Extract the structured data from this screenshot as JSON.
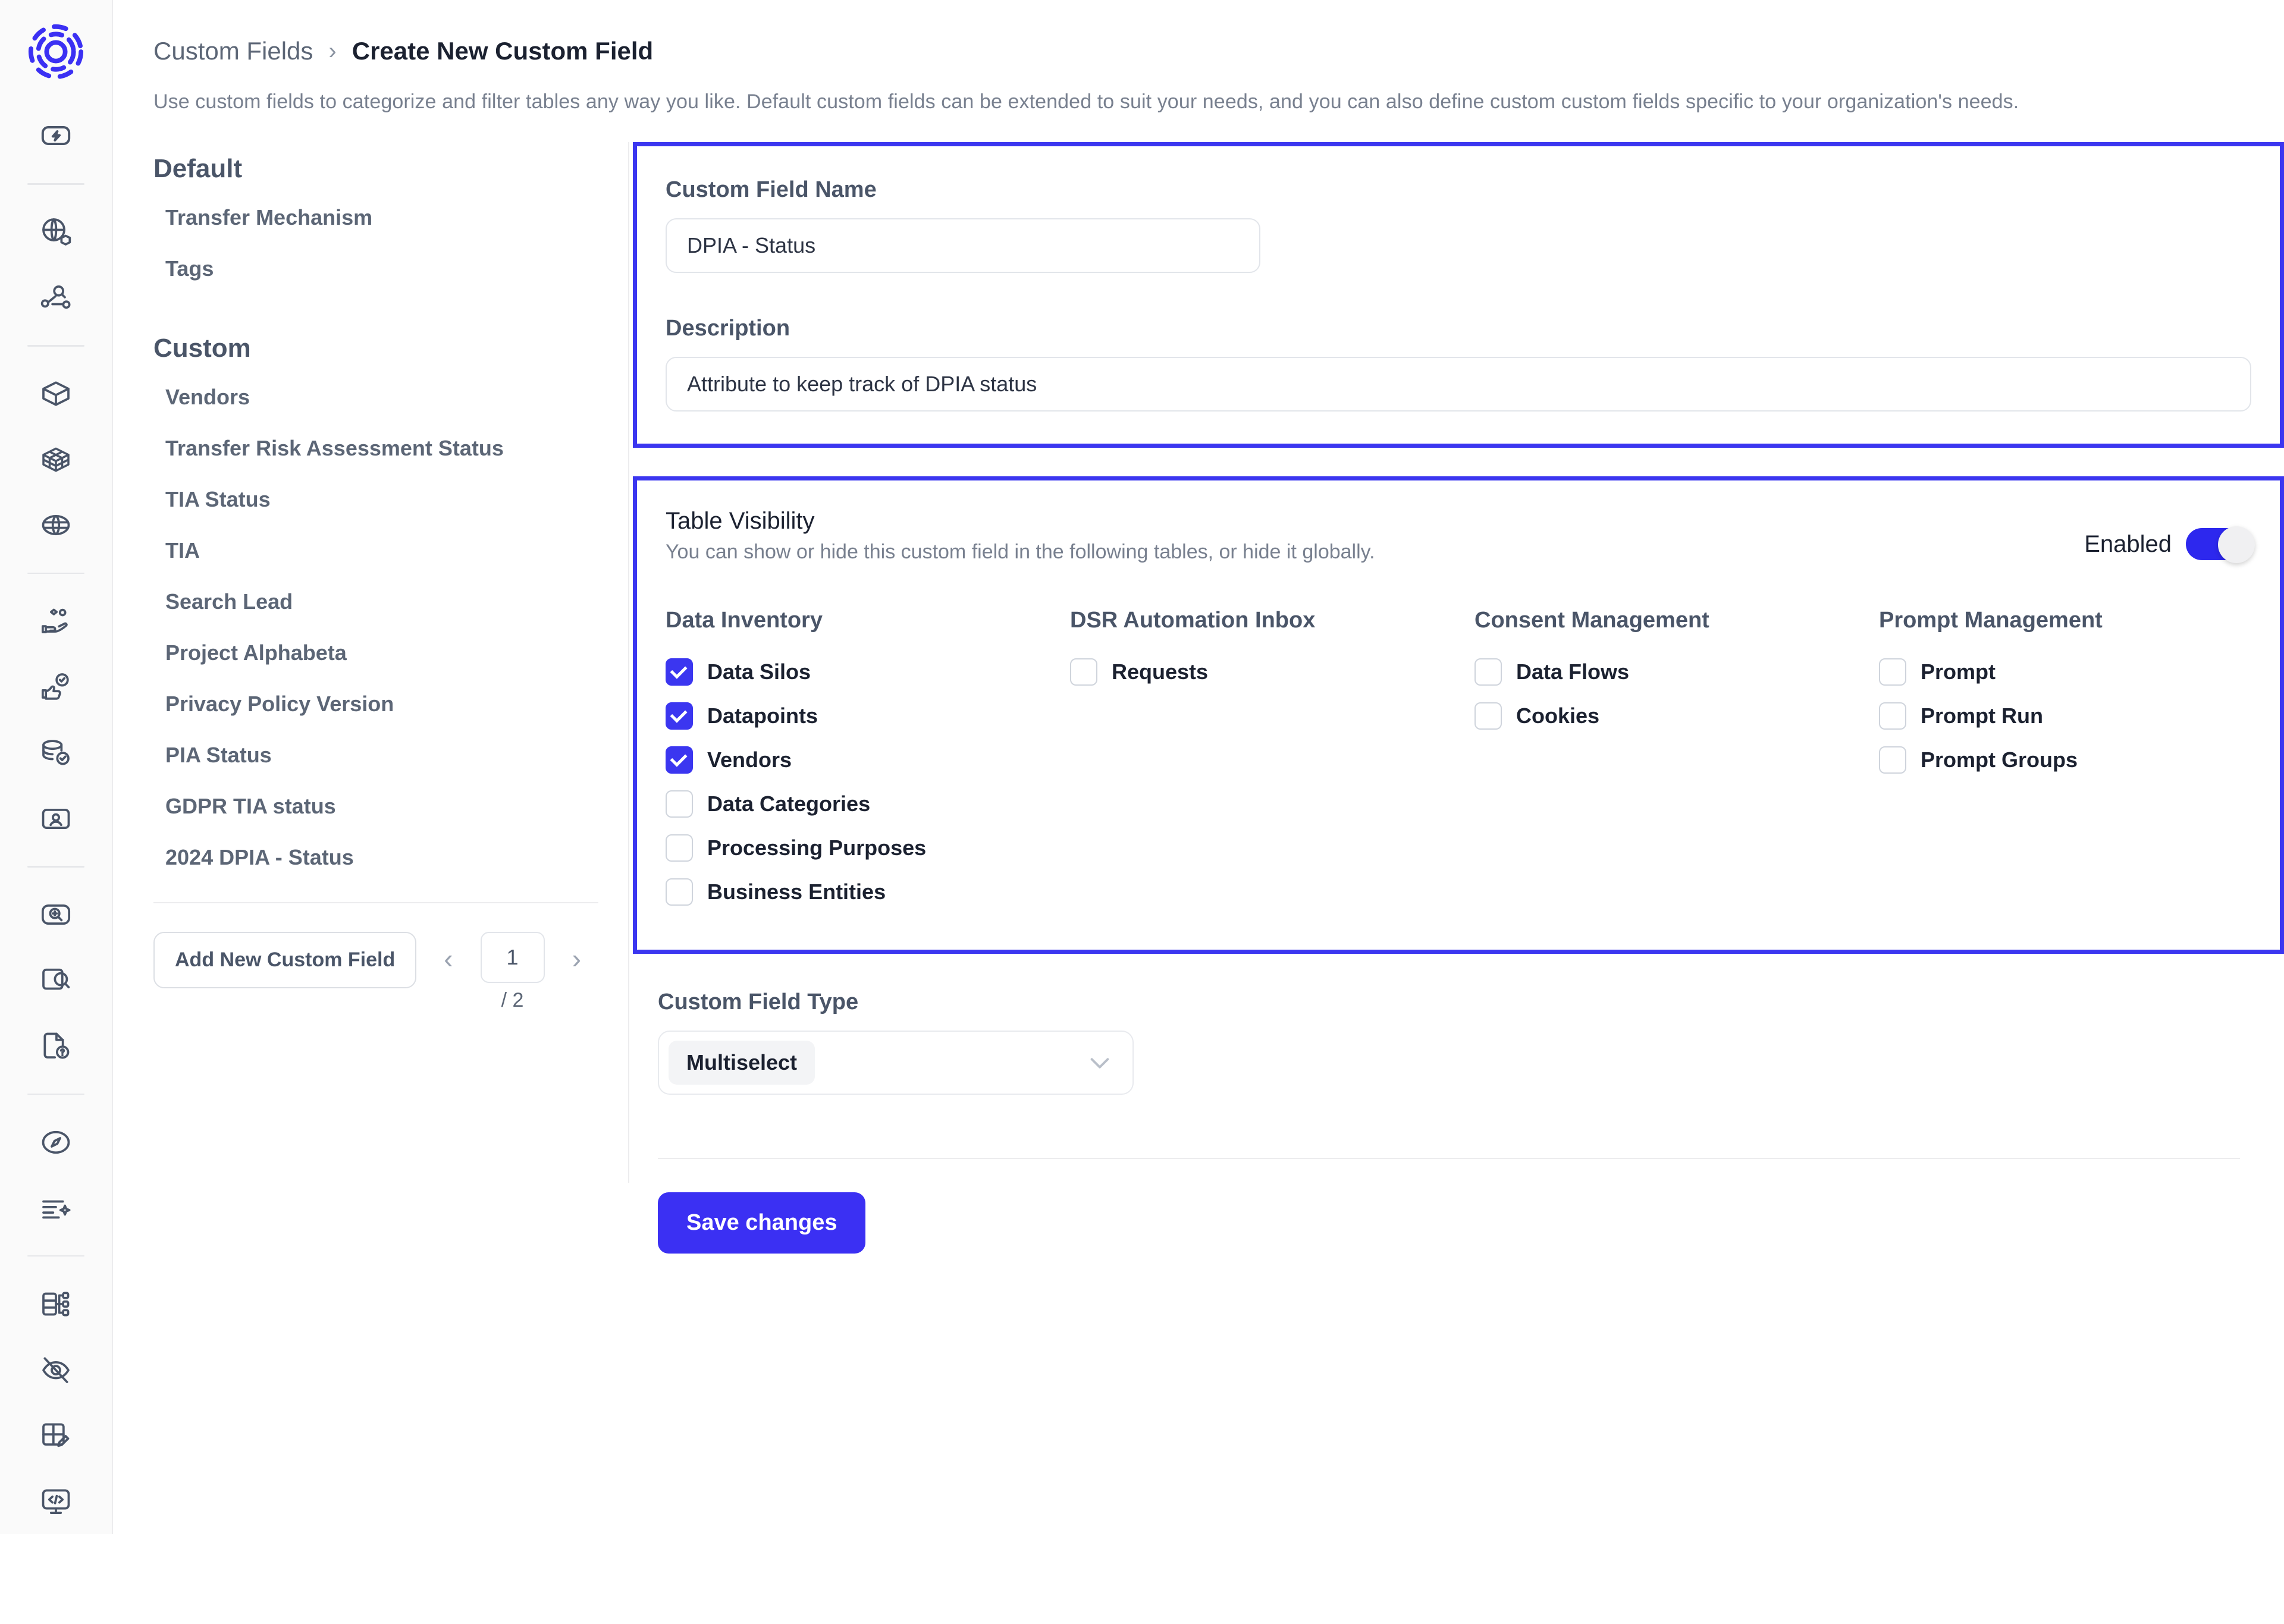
{
  "breadcrumb": {
    "root": "Custom Fields",
    "separator": "›",
    "current": "Create New Custom Field"
  },
  "page_description": "Use custom fields to categorize and filter tables any way you like. Default custom fields can be extended to suit your needs, and you can also define custom custom fields specific to your organization's needs.",
  "rail": {
    "logo_name": "concentric-rings-logo",
    "icons": [
      {
        "name": "lightning-badge-icon"
      },
      {
        "name": "globe-box-icon"
      },
      {
        "name": "data-lineage-search-icon"
      },
      {
        "name": "box-icon"
      },
      {
        "name": "crate-grid-icon"
      },
      {
        "name": "globe-icon"
      },
      {
        "name": "hand-coins-icon"
      },
      {
        "name": "thumbs-up-check-icon"
      },
      {
        "name": "database-check-icon"
      },
      {
        "name": "id-card-icon"
      },
      {
        "name": "scan-zoom-icon"
      },
      {
        "name": "window-search-icon"
      },
      {
        "name": "document-question-icon"
      },
      {
        "name": "compass-icon"
      },
      {
        "name": "list-sparkle-icon"
      },
      {
        "name": "schema-tree-icon"
      },
      {
        "name": "eye-off-icon"
      },
      {
        "name": "layout-edit-icon"
      },
      {
        "name": "code-monitor-icon"
      }
    ]
  },
  "field_list": {
    "default_group_title": "Default",
    "default_items": [
      {
        "label": "Transfer Mechanism"
      },
      {
        "label": "Tags"
      }
    ],
    "custom_group_title": "Custom",
    "custom_items": [
      {
        "label": "Vendors"
      },
      {
        "label": "Transfer Risk Assessment Status"
      },
      {
        "label": "TIA Status"
      },
      {
        "label": "TIA"
      },
      {
        "label": "Search Lead"
      },
      {
        "label": "Project Alphabeta"
      },
      {
        "label": "Privacy Policy Version"
      },
      {
        "label": "PIA Status"
      },
      {
        "label": "GDPR TIA status"
      },
      {
        "label": "2024 DPIA - Status"
      }
    ],
    "add_button_label": "Add New Custom Field",
    "pagination": {
      "prev_icon": "‹",
      "next_icon": "›",
      "current_page": "1",
      "total_label": "/ 2"
    }
  },
  "form": {
    "name_label": "Custom Field Name",
    "name_value": "DPIA - Status",
    "description_label": "Description",
    "description_value": "Attribute to keep track of DPIA status"
  },
  "table_visibility": {
    "title": "Table Visibility",
    "subtitle": "You can show or hide this custom field in the following tables, or hide it globally.",
    "toggle_label": "Enabled",
    "toggle_on": true,
    "columns": [
      {
        "title": "Data Inventory",
        "options": [
          {
            "label": "Data Silos",
            "checked": true
          },
          {
            "label": "Datapoints",
            "checked": true
          },
          {
            "label": "Vendors",
            "checked": true
          },
          {
            "label": "Data Categories",
            "checked": false
          },
          {
            "label": "Processing Purposes",
            "checked": false
          },
          {
            "label": "Business Entities",
            "checked": false
          }
        ]
      },
      {
        "title": "DSR Automation Inbox",
        "options": [
          {
            "label": "Requests",
            "checked": false
          }
        ]
      },
      {
        "title": "Consent Management",
        "options": [
          {
            "label": "Data Flows",
            "checked": false
          },
          {
            "label": "Cookies",
            "checked": false
          }
        ]
      },
      {
        "title": "Prompt Management",
        "options": [
          {
            "label": "Prompt",
            "checked": false
          },
          {
            "label": "Prompt Run",
            "checked": false
          },
          {
            "label": "Prompt Groups",
            "checked": false
          }
        ]
      }
    ]
  },
  "field_type": {
    "label": "Custom Field Type",
    "selected": "Multiselect",
    "chevron_icon": "chevron-down-icon"
  },
  "save_button_label": "Save changes",
  "colors": {
    "accent": "#3b30f3",
    "highlight_border": "#3b36f0",
    "toggle_on": "#2d28ee",
    "text_dark": "#1b2130",
    "text_muted": "#78808f"
  }
}
